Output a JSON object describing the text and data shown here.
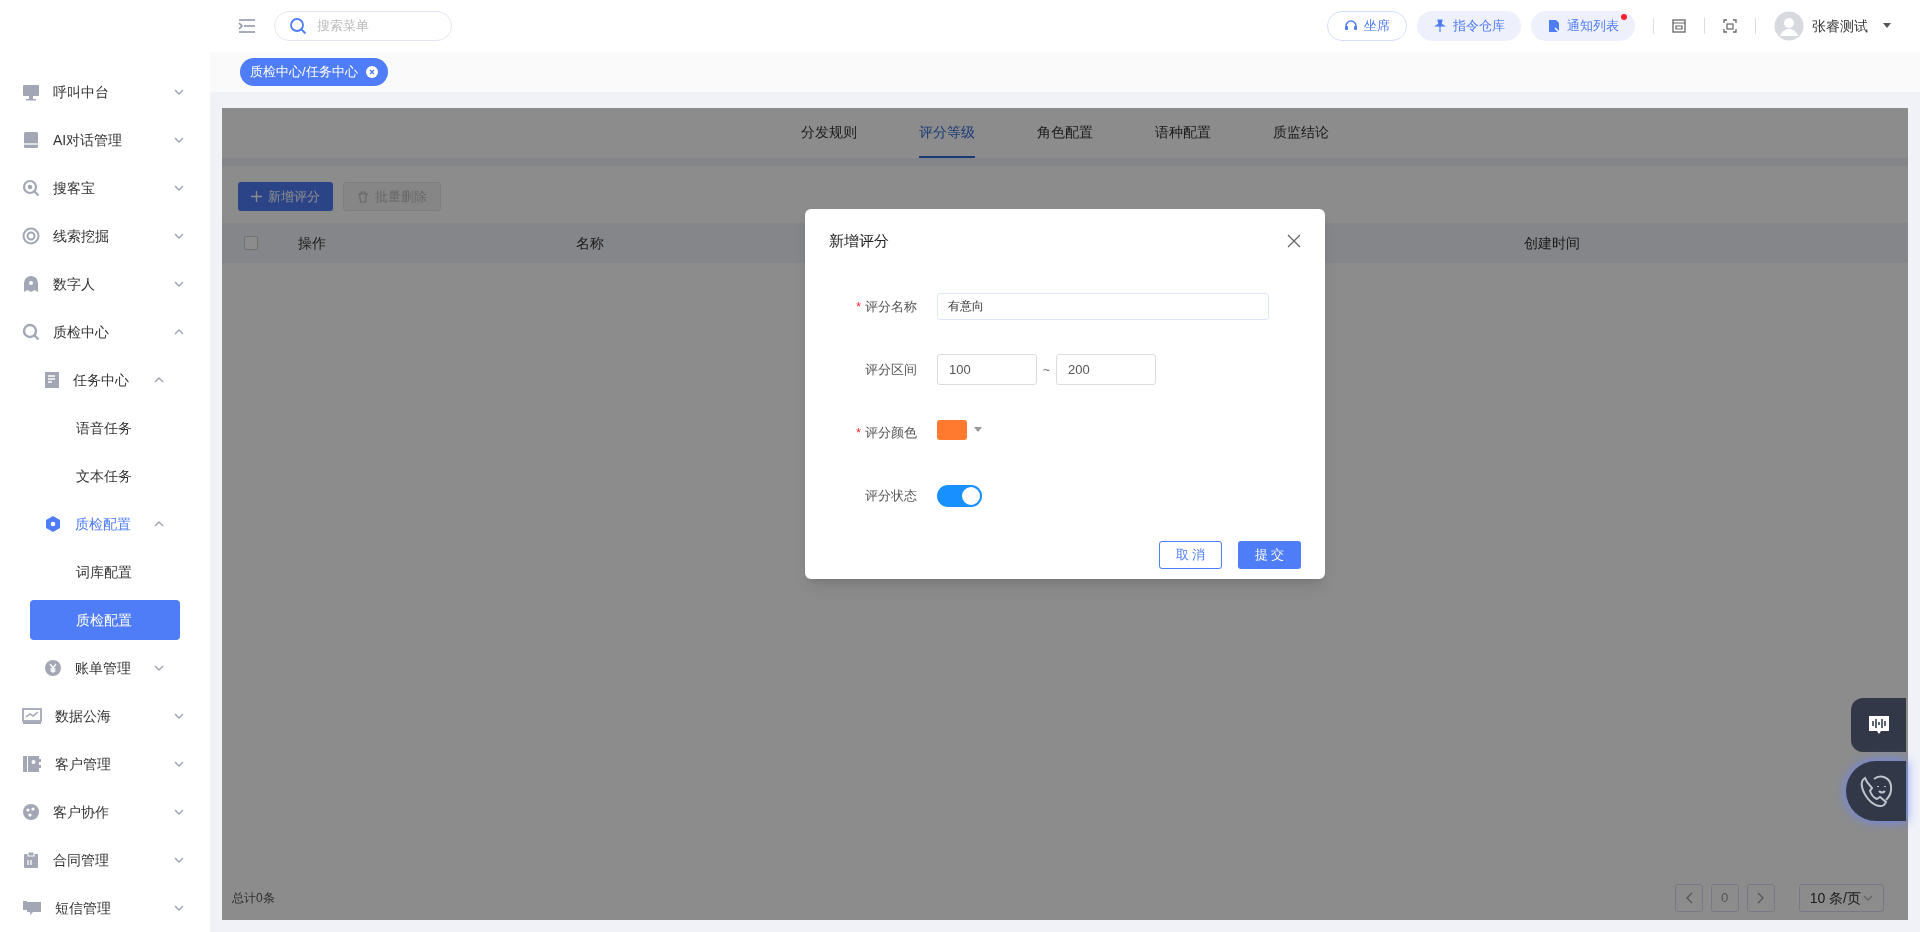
{
  "header": {
    "search": {
      "placeholder": "搜索菜单"
    },
    "actions": [
      {
        "label": "坐席",
        "kind": "outline",
        "badge": false
      },
      {
        "label": "指令仓库",
        "kind": "soft",
        "badge": false
      },
      {
        "label": "通知列表",
        "kind": "soft",
        "badge": true
      }
    ],
    "user": {
      "name": "张睿测试"
    }
  },
  "tags": [
    {
      "label": "质检中心/任务中心",
      "selected": true
    }
  ],
  "sidebar": {
    "items": [
      {
        "label": "呼叫中台",
        "expanded": false
      },
      {
        "label": "AI对话管理",
        "expanded": false
      },
      {
        "label": "搜客宝",
        "expanded": false
      },
      {
        "label": "线索挖掘",
        "expanded": false
      },
      {
        "label": "数字人",
        "expanded": false
      },
      {
        "label": "质检中心",
        "expanded": true,
        "children": [
          {
            "label": "任务中心",
            "expanded": true,
            "children": [
              {
                "label": "语音任务",
                "selected": false
              },
              {
                "label": "文本任务",
                "selected": false
              }
            ]
          },
          {
            "label": "质检配置",
            "expanded": true,
            "children": [
              {
                "label": "词库配置",
                "selected": false
              },
              {
                "label": "质检配置",
                "selected": true
              }
            ]
          },
          {
            "label": "账单管理",
            "expanded": false
          }
        ]
      },
      {
        "label": "数据公海",
        "expanded": false
      },
      {
        "label": "客户管理",
        "expanded": false
      },
      {
        "label": "客户协作",
        "expanded": false
      },
      {
        "label": "合同管理",
        "expanded": false
      },
      {
        "label": "短信管理",
        "expanded": false
      }
    ]
  },
  "tabs": [
    {
      "label": "分发规则",
      "selected": false
    },
    {
      "label": "评分等级",
      "selected": true
    },
    {
      "label": "角色配置",
      "selected": false
    },
    {
      "label": "语种配置",
      "selected": false
    },
    {
      "label": "质监结论",
      "selected": false
    }
  ],
  "toolbar": [
    {
      "label": "新增评分",
      "disabled": false
    },
    {
      "label": "批量删除",
      "disabled": true
    }
  ],
  "table": {
    "select_all": {
      "checked": false
    },
    "columns": [
      "操作",
      "名称",
      "创建时间"
    ]
  },
  "footer": {
    "total": "总计0条",
    "page": "0",
    "page_size": "10 条/页"
  },
  "dialog": {
    "title": "新增评分",
    "required_mark": "*",
    "fields": [
      {
        "kind": "text",
        "label": "评分名称",
        "required": true,
        "value": "有意向"
      },
      {
        "kind": "range",
        "label": "评分区间",
        "required": false,
        "from": "100",
        "separator": "~",
        "to": "200"
      },
      {
        "kind": "color",
        "label": "评分颜色",
        "required": true,
        "color": "#ff7a2f"
      },
      {
        "kind": "switch",
        "label": "评分状态",
        "required": false,
        "on": true
      }
    ],
    "buttons": [
      {
        "label": "取 消",
        "kind": "secondary"
      },
      {
        "label": "提 交",
        "kind": "primary"
      }
    ]
  }
}
